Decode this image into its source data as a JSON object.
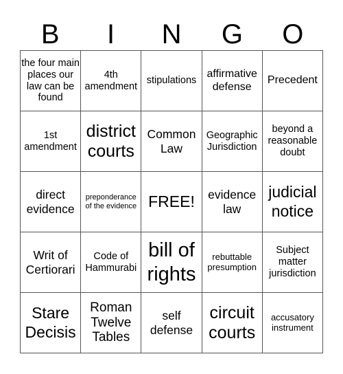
{
  "header": {
    "letters": [
      "B",
      "I",
      "N",
      "G",
      "O"
    ]
  },
  "cells": [
    [
      "the four main places our law can be found",
      "4th amendment",
      "stipulations",
      "affirmative defense",
      "Precedent"
    ],
    [
      "1st amendment",
      "district courts",
      "Common Law",
      "Geographic Jurisdiction",
      "beyond a reasonable doubt"
    ],
    [
      "direct evidence",
      "preponderance of the evidence",
      "FREE!",
      "evidence law",
      "judicial notice"
    ],
    [
      "Writ of Certiorari",
      "Code of Hammurabi",
      "bill of rights",
      "rebuttable presumption",
      "Subject matter jurisdiction"
    ],
    [
      "Stare Decisis",
      "Roman Twelve Tables",
      "self defense",
      "circuit courts",
      "accusatory instrument"
    ]
  ]
}
